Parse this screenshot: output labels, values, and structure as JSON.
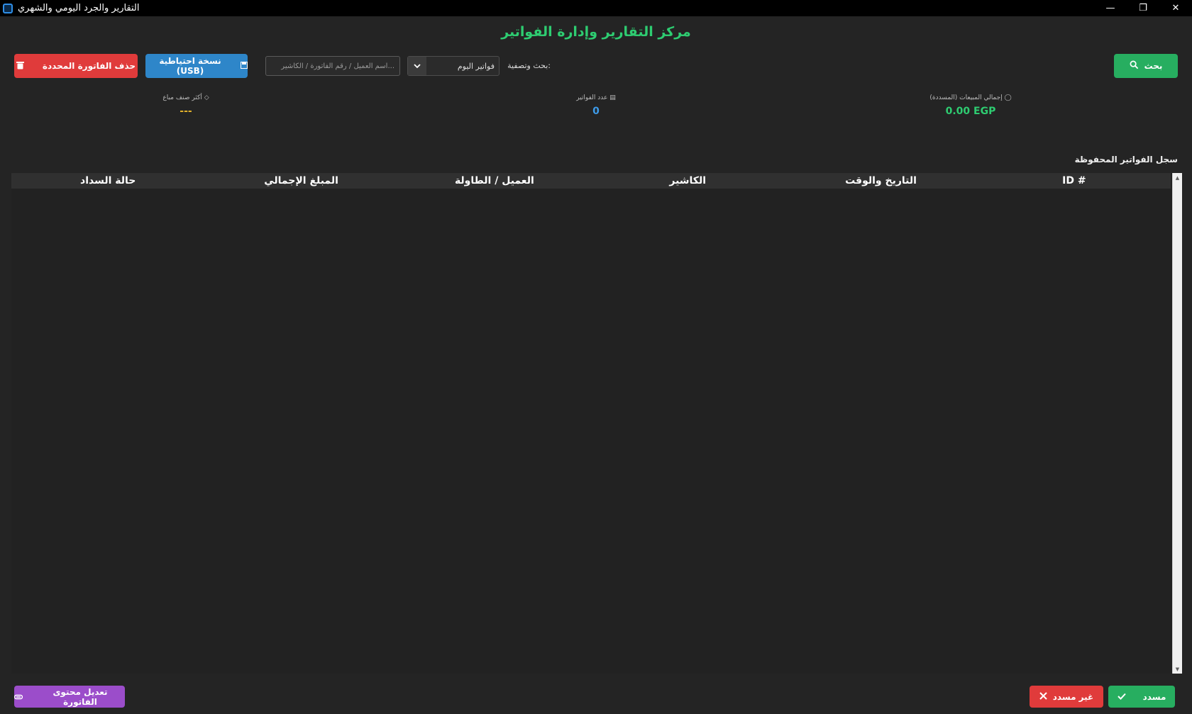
{
  "window": {
    "title": "التقارير والجرد اليومي والشهري",
    "minimize": "—",
    "restore": "❐",
    "close": "✕"
  },
  "header": {
    "title": "مركز التقارير وإدارة الفواتير"
  },
  "toolbar": {
    "search_button": "بحث",
    "filter_label": ":بحث وتصفية",
    "filter_selected": "فواتير اليوم",
    "search_placeholder": "...اسم العميل / رقم الفاتورة / الكاشير",
    "search_value": "",
    "backup_button": "نسخة احتياطية (USB)",
    "delete_button": "حذف الفاتورة المحددة"
  },
  "stats": {
    "sales_label": "إجمالي المبيعات (المسددة)",
    "sales_value": "0.00 EGP",
    "count_label": "عدد الفواتير",
    "count_value": "0",
    "top_label": "أكثر صنف مباع",
    "top_value": "---"
  },
  "table": {
    "section_title": "سجل الفواتير المحفوظة",
    "columns": [
      "# ID",
      "التاريخ والوقت",
      "الكاشير",
      "العميل / الطاولة",
      "المبلغ الإجمالي",
      "حالة السداد"
    ],
    "rows": []
  },
  "footer": {
    "paid_button": "مسدد",
    "unpaid_button": "غير مسدد",
    "edit_button": "تعديل محتوى الفاتورة"
  },
  "colors": {
    "accent_green": "#2ecc71",
    "danger_red": "#e03b3b",
    "info_blue": "#2e86c9",
    "purple": "#9b4dca",
    "count_blue": "#3d9be9",
    "top_gold": "#e1b12c"
  }
}
